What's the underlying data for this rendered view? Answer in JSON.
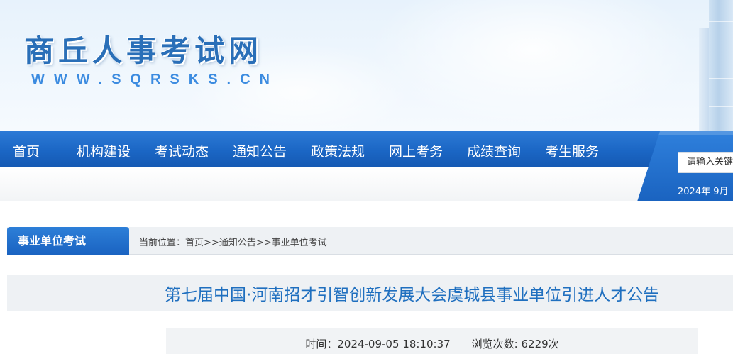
{
  "header": {
    "site_name": "商丘人事考试网",
    "site_url": "WWW.SQRSKS.CN"
  },
  "nav": {
    "items": [
      {
        "label": "首页"
      },
      {
        "label": "机构建设"
      },
      {
        "label": "考试动态"
      },
      {
        "label": "通知公告"
      },
      {
        "label": "政策法规"
      },
      {
        "label": "网上考务"
      },
      {
        "label": "成绩查询"
      },
      {
        "label": "考生服务"
      }
    ]
  },
  "search": {
    "placeholder": "请输入关键"
  },
  "date_partial": "2024年 9月",
  "section": {
    "title": "事业单位考试"
  },
  "breadcrumb": {
    "prefix": "当前位置：",
    "items": [
      "首页",
      ">>",
      "通知公告",
      ">>",
      "事业单位考试"
    ]
  },
  "article": {
    "title": "第七届中国·河南招才引智创新发展大会虞城县事业单位引进人才公告",
    "time_label": "时间：",
    "time_value": "2024-09-05 18:10:37",
    "views_label": "浏览次数: ",
    "views_value": "6229次"
  },
  "colors": {
    "brand_blue": "#1b66c4",
    "title_blue": "#1f6fbf"
  }
}
